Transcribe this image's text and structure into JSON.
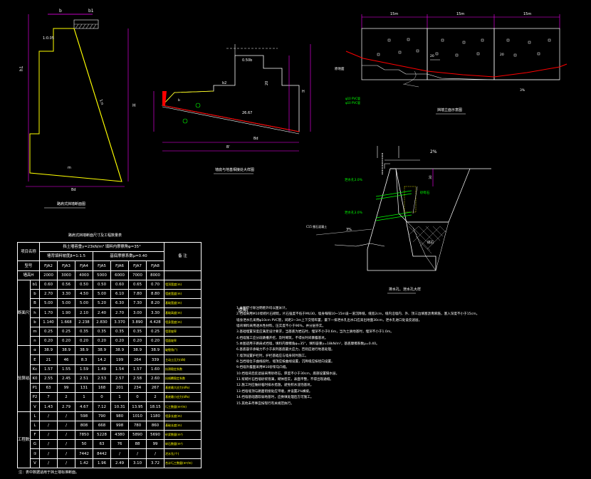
{
  "captions": {
    "wall_section": "路肩式挡墙断面图",
    "foundation_detail": "墙底与地基相接处大样图",
    "elevation": "挡墙立面示意图",
    "drainage_detail": "排水孔、泄水孔大样",
    "table_title": "路肩式挡墙断面尺寸及工程数量表"
  },
  "labels": {
    "b": "b",
    "b1": "b1",
    "b2": "b2",
    "ratio_1_005": "1:0.05",
    "ratio_1_n": "1:n",
    "h": "H",
    "h1": "h1",
    "m_label": "m",
    "bd": "Bd",
    "b_prime": "B'",
    "dim_050": "0.50b",
    "dim_20": "20",
    "dim_26": "26.67",
    "dim_30": "30",
    "two_percent": "2%",
    "three_percent": "3%",
    "dim_15m_a": "15m",
    "dim_15m_b": "15m",
    "dim_15m_c": "15m",
    "pipe_1": "泄水孔3.0%",
    "pipe_2": "泄水孔3.0%",
    "sand_gravel": "砂砾石",
    "gravel": "碎石",
    "waterproof": "C15 细石混凝土",
    "drain_a": "φ10 PVC管",
    "drain_b": "φ10 PVC管",
    "soil": "原地面",
    "notes_title": "说明"
  },
  "table": {
    "header": {
      "item": "项目名称",
      "group_top": "挡土墙容重γ=23kN/m³  填料内摩擦角φ=35°",
      "group_sub_a": "墙背填料坡度β=1:1.5",
      "group_sub_b": "基底摩擦系数μ=0.40",
      "remark": "备  注",
      "type_label": "型号",
      "types": [
        "FJA2",
        "FJA3",
        "FJA4",
        "FJA5",
        "FJA6",
        "FJA7",
        "FJA8"
      ],
      "height_label": "墙高H",
      "heights": [
        "2000",
        "3000",
        "4000",
        "5000",
        "6000",
        "7000",
        "8000"
      ]
    },
    "sections": [
      {
        "group": "断面尺寸",
        "rows": [
          {
            "sym": "b1",
            "vals": [
              "0.60",
              "0.56",
              "0.50",
              "0.50",
              "0.60",
              "0.65",
              "0.70"
            ],
            "note": "墙顶宽度(m)"
          },
          {
            "sym": "b",
            "vals": [
              "2.70",
              "3.30",
              "4.50",
              "5.00",
              "6.10",
              "7.80",
              "8.80"
            ],
            "note": "墙底宽度(m)"
          },
          {
            "sym": "B",
            "vals": [
              "5.00",
              "5.00",
              "5.00",
              "5.20",
              "6.30",
              "7.30",
              "8.20"
            ],
            "note": "基础宽度(m)"
          },
          {
            "sym": "h",
            "vals": [
              "1.70",
              "1.90",
              "2.10",
              "2.40",
              "2.70",
              "3.00",
              "3.30"
            ],
            "note": "基础高度(m)"
          },
          {
            "sym": "b",
            "vals": [
              "1.140",
              "1.668",
              "2.238",
              "2.830",
              "3.370",
              "3.890",
              "4.428"
            ],
            "note": "墙身宽度(m)"
          },
          {
            "sym": "m",
            "vals": [
              "0.25",
              "0.25",
              "0.35",
              "0.35",
              "0.35",
              "0.35",
              "0.25"
            ],
            "note": "墙背坡率"
          },
          {
            "sym": "n",
            "vals": [
              "0.20",
              "0.20",
              "0.20",
              "0.20",
              "0.20",
              "0.20",
              "0.20"
            ],
            "note": "墙面坡率"
          }
        ]
      },
      {
        "group": "验算结果",
        "rows": [
          {
            "sym": "α",
            "vals": [
              "38.9",
              "38.9",
              "38.9",
              "38.9",
              "38.9",
              "38.9",
              "38.9"
            ],
            "note": "破裂角(°)"
          },
          {
            "sym": "E",
            "vals": [
              "21",
              "46",
              "8.3",
              "14.2",
              "199",
              "264",
              "339"
            ],
            "note": "主动土压力(kN)"
          },
          {
            "sym": "Kc",
            "vals": [
              "1.57",
              "1.55",
              "1.59",
              "1.49",
              "1.54",
              "1.57",
              "1.60"
            ],
            "note": "抗滑稳定系数"
          },
          {
            "sym": "K0",
            "vals": [
              "2.55",
              "2.45",
              "2.51",
              "2.53",
              "2.57",
              "2.58",
              "2.60"
            ],
            "note": "抗倾覆稳定系数"
          },
          {
            "sym": "P1",
            "vals": [
              "63",
              "99",
              "131",
              "168",
              "201",
              "234",
              "267"
            ],
            "note": "基底最大应力(kPa)"
          },
          {
            "sym": "P2",
            "vals": [
              "7",
              "2",
              "1",
              "0",
              "1",
              "0",
              "2"
            ],
            "note": "基底最小应力(kPa)"
          },
          {
            "sym": "V",
            "vals": [
              "1.43",
              "2.79",
              "4.67",
              "7.12",
              "10.31",
              "13.95",
              "18.15"
            ],
            "note": "圬工数量(m³/m)"
          }
        ]
      },
      {
        "group": "工程数量",
        "rows": [
          {
            "sym": "L",
            "vals": [
              "/",
              "/",
              "598",
              "790",
              "980",
              "1010",
              "1180"
            ],
            "note": "墙身长度(m)"
          },
          {
            "sym": "L",
            "vals": [
              "/",
              "/",
              "808",
              "668",
              "998",
              "780",
              "860"
            ],
            "note": "基础长度(m)"
          },
          {
            "sym": "F",
            "vals": [
              "/",
              "/",
              "7850",
              "5228",
              "4380",
              "5890",
              "5690"
            ],
            "note": "砂浆数量(m³)"
          },
          {
            "sym": "G",
            "vals": [
              "/",
              "/",
              "50",
              "63",
              "76",
              "88",
              "99"
            ],
            "note": "碎石数量(m³)"
          },
          {
            "sym": "①",
            "vals": [
              "/",
              "/",
              "7442",
              "8442",
              "/",
              "/",
              "/"
            ],
            "note": "泄水孔(个)"
          },
          {
            "sym": "V",
            "vals": [
              "/",
              "/",
              "1.42",
              "1.96",
              "2.49",
              "3.10",
              "3.72"
            ],
            "note": "合计圬工数量(m³/m)"
          }
        ]
      }
    ],
    "footnote": "注：表中数据适用于挡土墙标准断面。"
  },
  "notes": [
    "1.本图尺寸除注明者外均以厘米计。",
    "2.挡墙采用M10浆砌片石砌筑，片石强度不低于MU30，墙身每隔10~15m设一道沉降缝，缝宽2cm，缝内沿墙内、外、顶三边填塞沥青麻筋，塞入深度不小于15cm。",
    "  墙身泄水孔采用φ10cm PVC管，间距2~3m上下交错布置，最下一排泄水孔出水口应高出地面30cm，泄水孔进口处设反滤层。",
    "  墙背填料采用透水性材料，压实度不小于96%，并分层夯实。",
    "3.基础埋置深度应满足设计要求，当基底为岩石时，埋深不小于0.6m，当为土质地基时，埋深不小于1.0m。",
    "4.挡墙施工应分段跳槽开挖，及时砌筑，不得长时间暴露基坑。",
    "5.本图适用于路肩式挡墙，填料内摩擦角φ=35°，填料容重γ=18kN/m³，基底摩擦系数μ=0.40。",
    "6.基底容许承载力不小于表列基底最大应力，否则应进行地基处理。",
    "7.墙顶设置护栏时，护栏基础应与墙身同时施工。",
    "8.当挡墙位于曲线段时，墙顶应按曲线设置，沉降缝应按径向设置。",
    "9.挡墙外露面采用M10砂浆勾凸缝。",
    "10.挡墙背后反滤层采用砂砾石，厚度不小于30cm，底部设置隔水层。",
    "11.浆砌片石挡墙砂浆饱满，砌体密实，表面平整，不得出现通缝。",
    "12.施工时应做好临时排水措施，避免积水浸泡基坑。",
    "13.挡墙墙顶与路面衔接处应平顺，并设置2%横坡。",
    "14.挡墙基础遇软弱地基时，应换填处理后方可施工。",
    "15.其他未尽事宜按现行有关规范执行。"
  ]
}
